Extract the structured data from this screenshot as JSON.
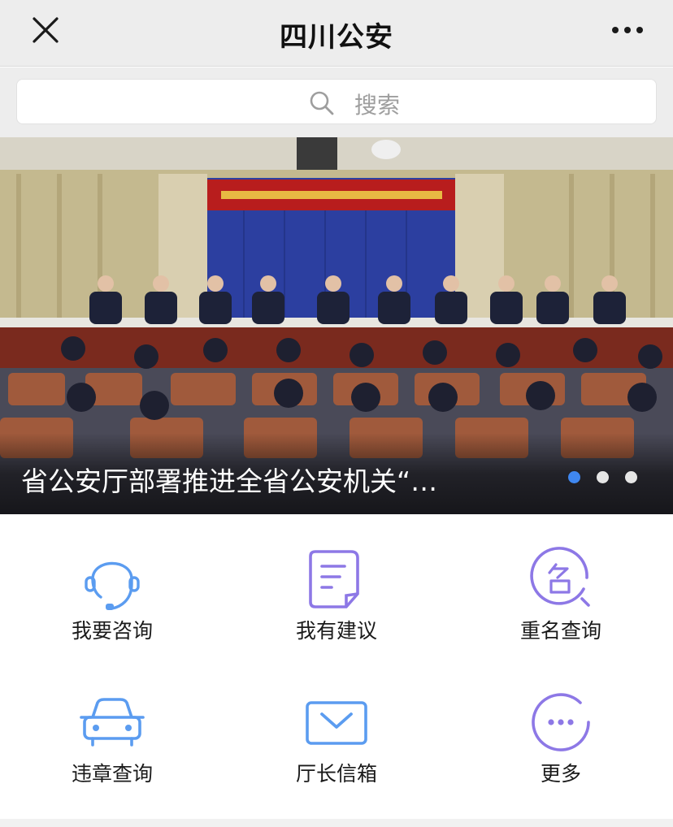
{
  "header": {
    "title": "四川公安",
    "close_icon": "close-icon",
    "more_icon": "more-dots-icon"
  },
  "search": {
    "placeholder": "搜索",
    "icon": "search-icon"
  },
  "banner": {
    "caption": "省公安厅部署推进全省公安机关“…",
    "slides_total": 3,
    "active_slide": 1,
    "accent_color": "#3f87f0"
  },
  "services": [
    {
      "label": "我要咨询",
      "icon": "headset-icon"
    },
    {
      "label": "我有建议",
      "icon": "document-icon"
    },
    {
      "label": "重名查询",
      "icon": "name-search-icon"
    },
    {
      "label": "违章查询",
      "icon": "car-icon"
    },
    {
      "label": "厅长信箱",
      "icon": "mailbox-icon"
    },
    {
      "label": "更多",
      "icon": "more-circle-icon"
    }
  ],
  "colors": {
    "icon_blue": "#5b9cf0",
    "icon_purple": "#8d78e6",
    "text": "#1a1a1a"
  }
}
